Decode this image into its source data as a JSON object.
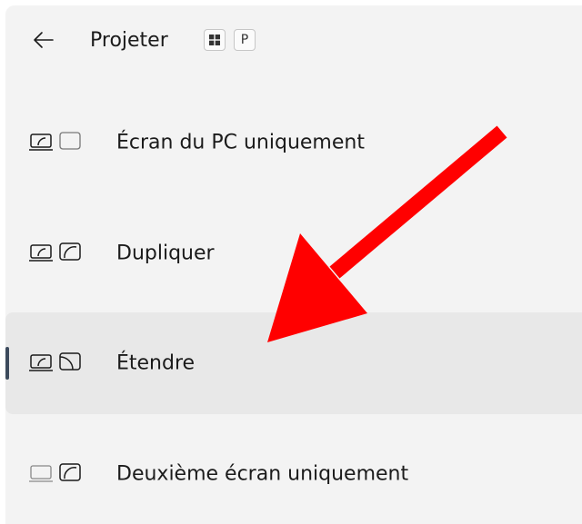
{
  "header": {
    "title": "Projeter",
    "shortcut_key": "P"
  },
  "options": [
    {
      "label": "Écran du PC uniquement",
      "selected": false
    },
    {
      "label": "Dupliquer",
      "selected": false
    },
    {
      "label": "Étendre",
      "selected": true
    },
    {
      "label": "Deuxième écran uniquement",
      "selected": false
    }
  ],
  "colors": {
    "panel_background": "#f3f3f3",
    "selected_background": "#e8e8e8",
    "selection_indicator": "#3c4a5c",
    "annotation_arrow": "#ff0000"
  }
}
